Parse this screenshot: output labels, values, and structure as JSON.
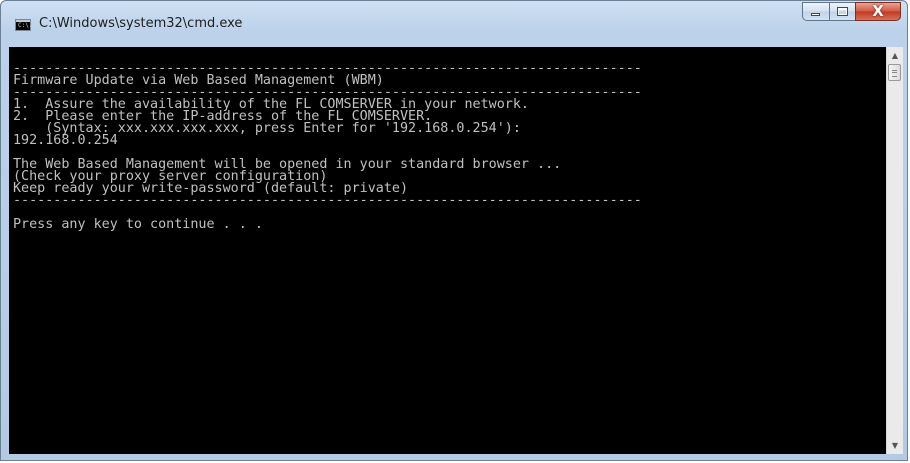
{
  "window": {
    "title": "C:\\Windows\\system32\\cmd.exe",
    "icon": "cmd-icon",
    "icon_text": "C:\\."
  },
  "caption_buttons": {
    "minimize_icon": "minimize-icon",
    "maximize_icon": "maximize-icon",
    "close_glyph": "X"
  },
  "console": {
    "background": "#000000",
    "foreground": "#c0c0c0",
    "lines": [
      "",
      "------------------------------------------------------------------------------",
      "Firmware Update via Web Based Management (WBM)",
      "------------------------------------------------------------------------------",
      "1.  Assure the availability of the FL COMSERVER in your network.",
      "2.  Please enter the IP-address of the FL COMSERVER.",
      "    (Syntax: xxx.xxx.xxx.xxx, press Enter for '192.168.0.254'):",
      "192.168.0.254",
      "",
      "The Web Based Management will be opened in your standard browser ...",
      "(Check your proxy server configuration)",
      "Keep ready your write-password (default: private)",
      "------------------------------------------------------------------------------",
      "",
      "Press any key to continue . . ."
    ]
  },
  "scrollbar": {
    "up_arrow": "▲",
    "down_arrow": "▼"
  }
}
